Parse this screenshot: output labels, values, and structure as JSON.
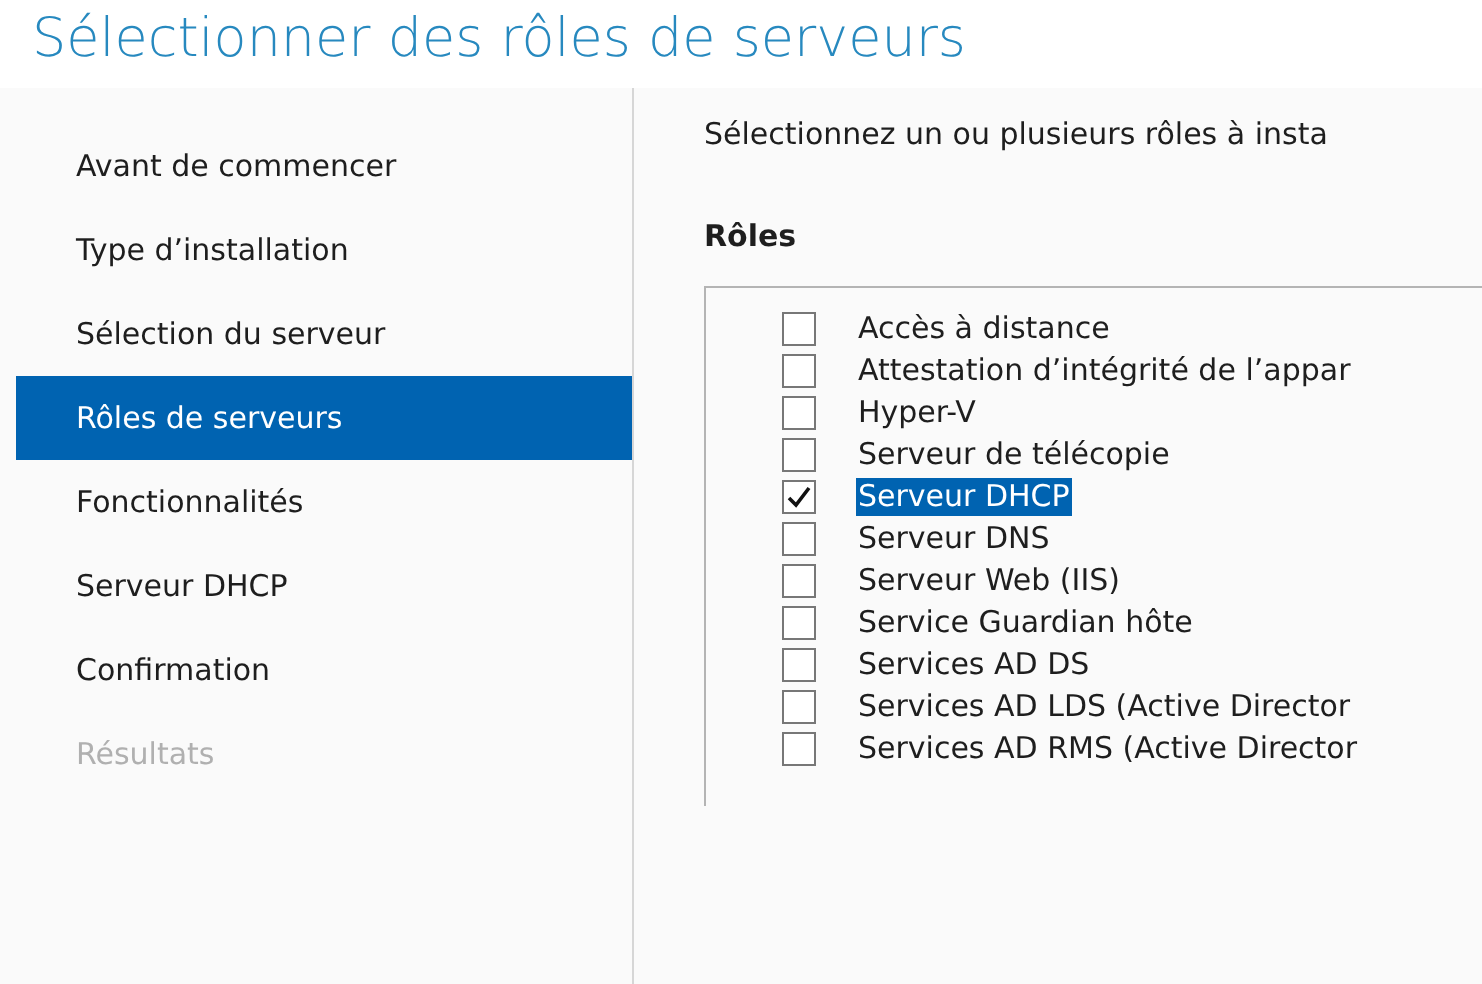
{
  "window": {
    "title": "Sélectionner des rôles de serveurs"
  },
  "sidebar": {
    "items": [
      {
        "label": "Avant de commencer",
        "selected": false,
        "disabled": false
      },
      {
        "label": "Type d’installation",
        "selected": false,
        "disabled": false
      },
      {
        "label": "Sélection du serveur",
        "selected": false,
        "disabled": false
      },
      {
        "label": "Rôles de serveurs",
        "selected": true,
        "disabled": false
      },
      {
        "label": "Fonctionnalités",
        "selected": false,
        "disabled": false
      },
      {
        "label": "Serveur DHCP",
        "selected": false,
        "disabled": false
      },
      {
        "label": "Confirmation",
        "selected": false,
        "disabled": false
      },
      {
        "label": "Résultats",
        "selected": false,
        "disabled": true
      }
    ]
  },
  "intro": "Sélectionnez un ou plusieurs rôles à insta",
  "roles": {
    "heading": "Rôles",
    "items": [
      {
        "label": "Accès à distance",
        "checked": false,
        "selected": false
      },
      {
        "label": "Attestation d’intégrité de l’appar",
        "checked": false,
        "selected": false
      },
      {
        "label": "Hyper-V",
        "checked": false,
        "selected": false
      },
      {
        "label": "Serveur de télécopie",
        "checked": false,
        "selected": false
      },
      {
        "label": "Serveur DHCP",
        "checked": true,
        "selected": true
      },
      {
        "label": "Serveur DNS",
        "checked": false,
        "selected": false
      },
      {
        "label": "Serveur Web (IIS)",
        "checked": false,
        "selected": false
      },
      {
        "label": "Service Guardian hôte",
        "checked": false,
        "selected": false
      },
      {
        "label": "Services AD DS",
        "checked": false,
        "selected": false
      },
      {
        "label": "Services AD LDS (Active Director",
        "checked": false,
        "selected": false
      },
      {
        "label": "Services AD RMS (Active Director",
        "checked": false,
        "selected": false
      }
    ]
  }
}
